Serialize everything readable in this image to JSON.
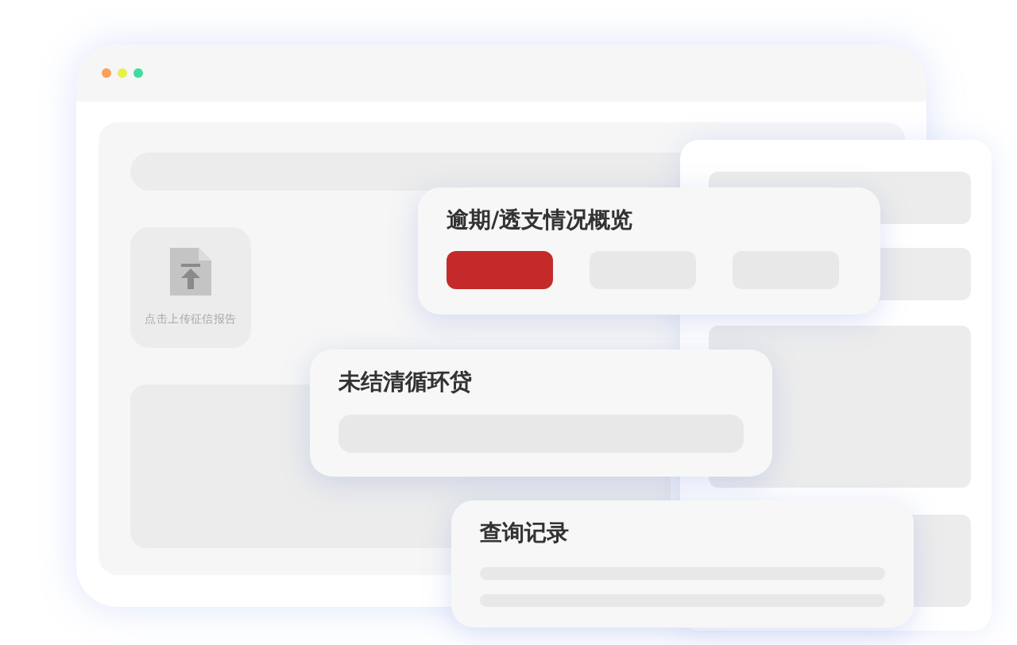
{
  "window": {
    "dots": [
      {
        "color": "#f9a05a"
      },
      {
        "color": "#e8f04a"
      },
      {
        "color": "#3fdca0"
      }
    ]
  },
  "upload": {
    "label": "点击上传征信报告"
  },
  "cards": [
    {
      "title": "逾期/透支情况概览",
      "kind": "pills",
      "pills": [
        {
          "selected": true
        },
        {
          "selected": false
        },
        {
          "selected": false
        }
      ]
    },
    {
      "title": "未结清循环贷",
      "kind": "bar"
    },
    {
      "title": "查询记录",
      "kind": "lines"
    }
  ]
}
